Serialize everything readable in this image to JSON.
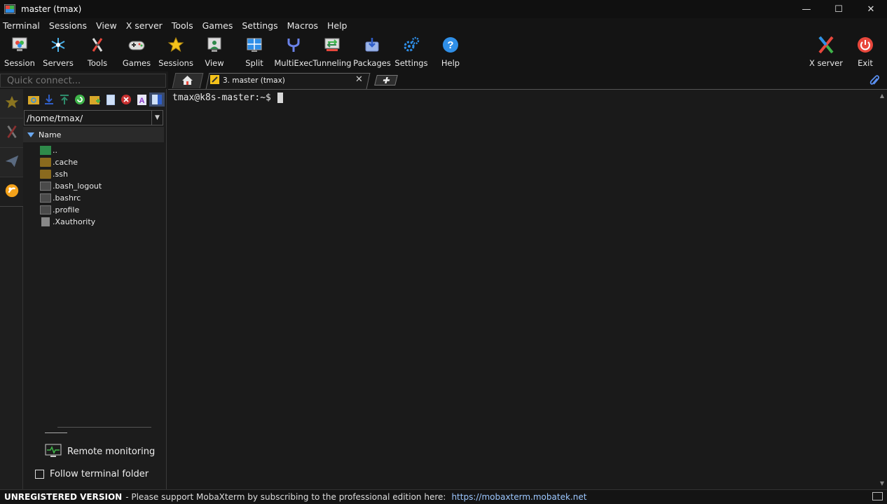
{
  "window": {
    "title": "master (tmax)",
    "controls": {
      "minimize": "—",
      "maximize": "☐",
      "close": "✕"
    }
  },
  "menu": [
    "Terminal",
    "Sessions",
    "View",
    "X server",
    "Tools",
    "Games",
    "Settings",
    "Macros",
    "Help"
  ],
  "toolbar": {
    "left": [
      {
        "label": "Session",
        "icon": "session-icon"
      },
      {
        "label": "Servers",
        "icon": "servers-icon"
      },
      {
        "label": "Tools",
        "icon": "tools-icon"
      },
      {
        "label": "Games",
        "icon": "gamepad-icon"
      },
      {
        "label": "Sessions",
        "icon": "star-icon"
      },
      {
        "label": "View",
        "icon": "view-icon"
      },
      {
        "label": "Split",
        "icon": "split-icon"
      },
      {
        "label": "MultiExec",
        "icon": "multiexec-icon"
      },
      {
        "label": "Tunneling",
        "icon": "tunneling-icon"
      },
      {
        "label": "Packages",
        "icon": "packages-icon"
      },
      {
        "label": "Settings",
        "icon": "gears-icon"
      },
      {
        "label": "Help",
        "icon": "help-icon"
      }
    ],
    "right": [
      {
        "label": "X server",
        "icon": "xserver-icon"
      },
      {
        "label": "Exit",
        "icon": "power-icon"
      }
    ]
  },
  "quick_connect": {
    "placeholder": "Quick connect..."
  },
  "tabs": {
    "session_tab": "3. master (tmax)",
    "close": "✕"
  },
  "file_browser": {
    "path": "/home/tmax/",
    "column_header": "Name",
    "files": [
      {
        "name": "..",
        "type": "parent"
      },
      {
        "name": ".cache",
        "type": "folder"
      },
      {
        "name": ".ssh",
        "type": "folder"
      },
      {
        "name": ".bash_logout",
        "type": "script"
      },
      {
        "name": ".bashrc",
        "type": "script"
      },
      {
        "name": ".profile",
        "type": "script"
      },
      {
        "name": ".Xauthority",
        "type": "file"
      }
    ],
    "remote_monitoring": "Remote monitoring",
    "follow_terminal_folder": "Follow terminal folder",
    "follow_checked": false
  },
  "terminal": {
    "prompt": "tmax@k8s-master:~$"
  },
  "statusbar": {
    "unregistered": "UNREGISTERED VERSION",
    "message": " -  Please support MobaXterm by subscribing to the professional edition here:",
    "link": "https://mobaxterm.mobatek.net"
  },
  "colors": {
    "background": "#1a1a1a",
    "accent_blue": "#2f8fe8",
    "link": "#9cc7ff",
    "exit_red": "#e8473c"
  }
}
